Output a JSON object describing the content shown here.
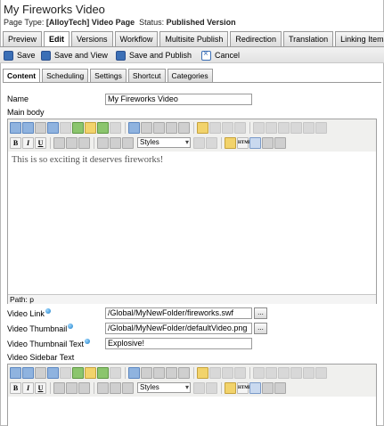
{
  "page": {
    "title": "My Fireworks Video",
    "page_type_label": "Page Type:",
    "page_type_value": "[AlloyTech] Video Page",
    "status_label": "Status:",
    "status_value": "Published Version"
  },
  "tabs": [
    "Preview",
    "Edit",
    "Versions",
    "Workflow",
    "Multisite Publish",
    "Redirection",
    "Translation",
    "Linking Items"
  ],
  "active_tab": "Edit",
  "toolbar": {
    "save": "Save",
    "save_view": "Save and View",
    "save_publish": "Save and Publish",
    "cancel": "Cancel"
  },
  "subtabs": [
    "Content",
    "Scheduling",
    "Settings",
    "Shortcut",
    "Categories"
  ],
  "active_subtab": "Content",
  "form": {
    "name_label": "Name",
    "name_value": "My Fireworks Video",
    "main_body_label": "Main body",
    "main_body_text": "This is so exciting it deserves fireworks!",
    "main_body_path": "Path: p",
    "video_link_label": "Video Link",
    "video_link_value": "/Global/MyNewFolder/fireworks.swf",
    "video_thumbnail_label": "Video Thumbnail",
    "video_thumbnail_value": "/Global/MyNewFolder/defaultVideo.png",
    "video_thumbnail_text_label": "Video Thumbnail Text",
    "video_thumbnail_text_value": "Explosive!",
    "video_sidebar_label": "Video Sidebar Text",
    "browse_label": "..."
  },
  "editor": {
    "styles_label": "Styles",
    "bold": "B",
    "italic": "I",
    "underline": "U",
    "html": "HTML"
  }
}
